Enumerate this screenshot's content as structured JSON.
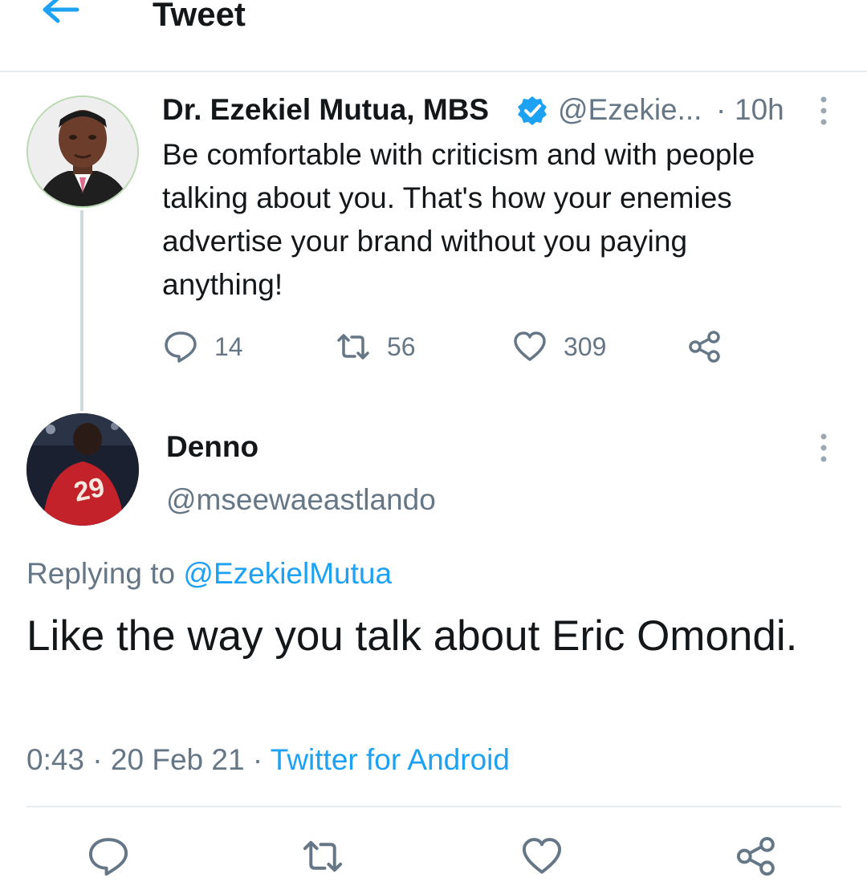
{
  "header": {
    "title": "Tweet"
  },
  "parent_tweet": {
    "name": "Dr. Ezekiel Mutua, MBS",
    "handle": "@Ezekie...",
    "separator": "·",
    "time": "10h",
    "text": "Be comfortable with criticism and with people talking about you. That's how your enemies advertise your brand without you paying anything!",
    "reply_count": "14",
    "retweet_count": "56",
    "like_count": "309"
  },
  "reply_tweet": {
    "name": "Denno",
    "handle": "@mseewaeastlando",
    "replying_prefix": "Replying to ",
    "replying_to": "@EzekielMutua",
    "text": "Like the way you talk about Eric Omondi.",
    "time": "0:43",
    "date": "20 Feb 21",
    "meta_separator": " · ",
    "source": "Twitter for Android"
  },
  "icons": {
    "back": "arrow-left-icon",
    "verified": "verified-badge-icon",
    "more": "more-vertical-icon",
    "reply": "reply-icon",
    "retweet": "retweet-icon",
    "like": "heart-icon",
    "share": "share-icon"
  },
  "colors": {
    "accent": "#1da1f2",
    "secondary_text": "#657786",
    "primary_text": "#14171a",
    "divider": "#e6ecf0"
  }
}
